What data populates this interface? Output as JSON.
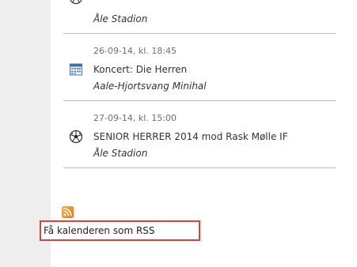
{
  "events": [
    {
      "date": "",
      "title": "",
      "venue": "Åle Stadion",
      "icon": "football-icon"
    },
    {
      "date": "26-09-14, kl. 18:45",
      "title": "Koncert: Die Herren",
      "venue": "Aale-Hjortsvang Minihal",
      "icon": "calendar-icon"
    },
    {
      "date": "27-09-14, kl. 15:00",
      "title": "SENIOR HERRER 2014 mod Rask Mølle IF",
      "venue": "Åle Stadion",
      "icon": "football-icon"
    }
  ],
  "rss": {
    "label": "Få kalenderen som RSS",
    "icon": "rss-icon"
  },
  "colors": {
    "rail": "#eeeeee",
    "divider": "#b8b8b8",
    "highlight": "#e0413a",
    "rss_orange": "#f7941d"
  }
}
